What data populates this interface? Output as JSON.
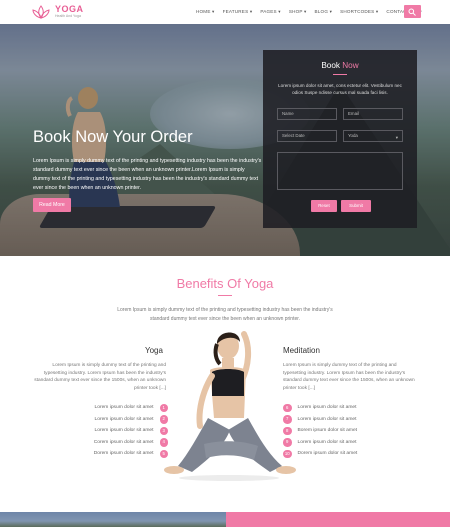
{
  "brand": {
    "name": "YOGA",
    "tagline": "Health And Yoga",
    "accent": "#f07aa6"
  },
  "nav": {
    "items": [
      "HOME ▾",
      "FEATURES ▾",
      "PAGES ▾",
      "SHOP ▾",
      "BLOG ▾",
      "SHORTCODES ▾",
      "CONTACT US ▾"
    ],
    "search_icon": "search-icon"
  },
  "hero": {
    "title": "Book Now Your Order",
    "text": "Lorem Ipsum is simply dummy text of the printing and typesetting industry has been the industry's standard dummy text ever since the been when an unknown printer.Lorem Ipsum is simply dummy text of the printing and typesetting industry has been the industry's standard dummy text ever since the been when an unknown printer.",
    "button": "Read More"
  },
  "booking": {
    "title_main": "Book ",
    "title_accent": "Now",
    "text": "Lorem ipsum dolor sit amet, cons ectetur elit. Vestibulum nec odios Suspe ndisse cursus mal suada faci lisis.",
    "name_placeholder": "Name",
    "email_placeholder": "Email",
    "date_placeholder": "Select Date",
    "select_value": "Yoda",
    "reset_label": "Reset",
    "submit_label": "Submit"
  },
  "benefits": {
    "title": "Benefits Of Yoga",
    "intro": "Lorem Ipsum is simply dummy text of the printing and typesetting industry has been the industry's standard dummy text ever since the been when an unknown printer.",
    "yoga": {
      "title": "Yoga",
      "text": "Lorem Ipsum is simply dummy text of the printing and typesetting industry. Lorem Ipsum has been the industry's standard dummy text ever since the 1500s, when an unknown printer took [...]",
      "items": [
        {
          "label": "Lorem ipsum dolor sit amet",
          "num": "1"
        },
        {
          "label": "Lorem ipsum dolor sit amet",
          "num": "2"
        },
        {
          "label": "Lorem ipsum dolor sit amet",
          "num": "3"
        },
        {
          "label": "Corem ipsum dolor sit amet",
          "num": "4"
        },
        {
          "label": "Dorem ipsum dolor sit amet",
          "num": "5"
        }
      ]
    },
    "meditation": {
      "title": "Meditation",
      "text": "Lorem Ipsum is simply dummy text of the printing and typesetting industry. Lorem Ipsum has been the industry's standard dummy text ever since the 1500s, when an unknown printer took [...]",
      "items": [
        {
          "label": "Lorem ipsum dolor sit amet",
          "num": "6"
        },
        {
          "label": "Lorem ipsum dolor sit amet",
          "num": "7"
        },
        {
          "label": "Borem ipsum dolor sit amet",
          "num": "8"
        },
        {
          "label": "Lorem ipsum dolor sit amet",
          "num": "9"
        },
        {
          "label": "Dorem ipsum dolor sit amet",
          "num": "10"
        }
      ]
    }
  }
}
